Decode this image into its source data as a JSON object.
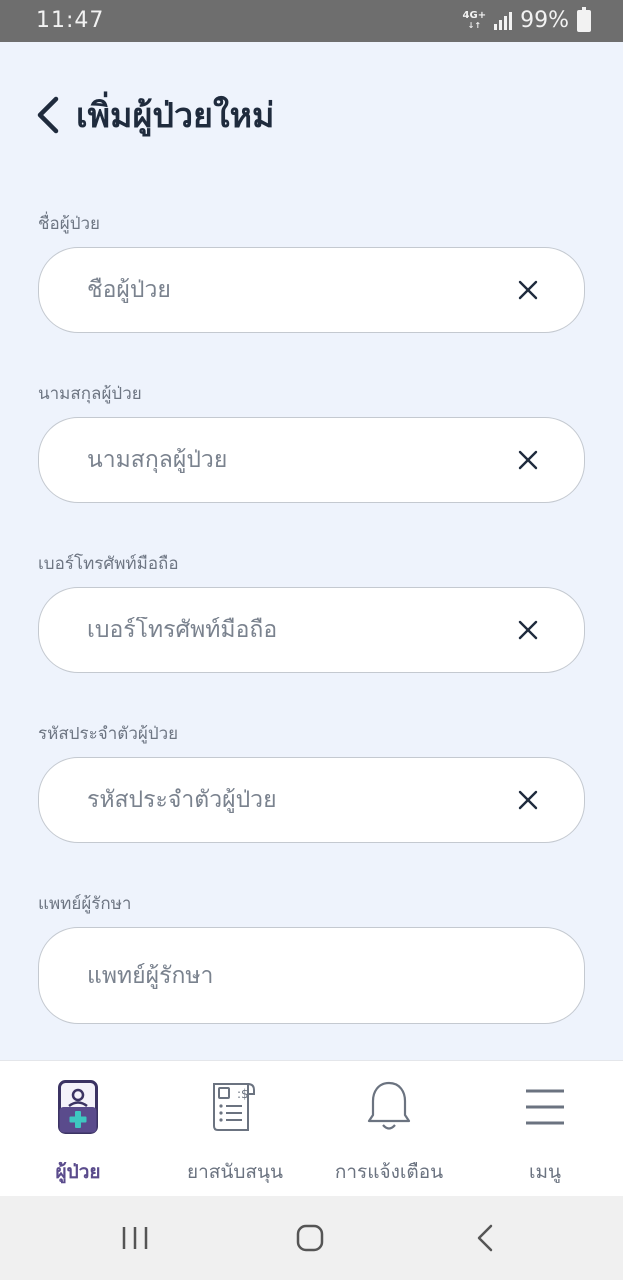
{
  "status_bar": {
    "time": "11:47",
    "network": "4G+",
    "battery": "99%"
  },
  "header": {
    "title": "เพิ่มผู้ป่วยใหม่"
  },
  "form": {
    "fields": [
      {
        "label": "ชื่อผู้ป่วย",
        "placeholder": "ชื่อผู้ป่วย",
        "value": ""
      },
      {
        "label": "นามสกุลผู้ป่วย",
        "placeholder": "นามสกุลผู้ป่วย",
        "value": ""
      },
      {
        "label": "เบอร์โทรศัพท์มือถือ",
        "placeholder": "เบอร์โทรศัพท์มือถือ",
        "value": ""
      },
      {
        "label": "รหัสประจำตัวผู้ป่วย",
        "placeholder": "รหัสประจำตัวผู้ป่วย",
        "value": ""
      },
      {
        "label": "แพทย์ผู้รักษา",
        "placeholder": "แพทย์ผู้รักษา",
        "value": ""
      }
    ]
  },
  "bottom_nav": {
    "items": [
      {
        "label": "ผู้ป่วย",
        "icon": "patient-icon",
        "active": true
      },
      {
        "label": "ยาสนับสนุน",
        "icon": "medicine-receipt-icon",
        "active": false
      },
      {
        "label": "การแจ้งเตือน",
        "icon": "bell-icon",
        "active": false
      },
      {
        "label": "เมนู",
        "icon": "menu-icon",
        "active": false
      }
    ]
  },
  "colors": {
    "background": "#eef3fc",
    "accent": "#5a4b8c",
    "cross": "#3ec7c0",
    "text": "#2e3a4b"
  }
}
